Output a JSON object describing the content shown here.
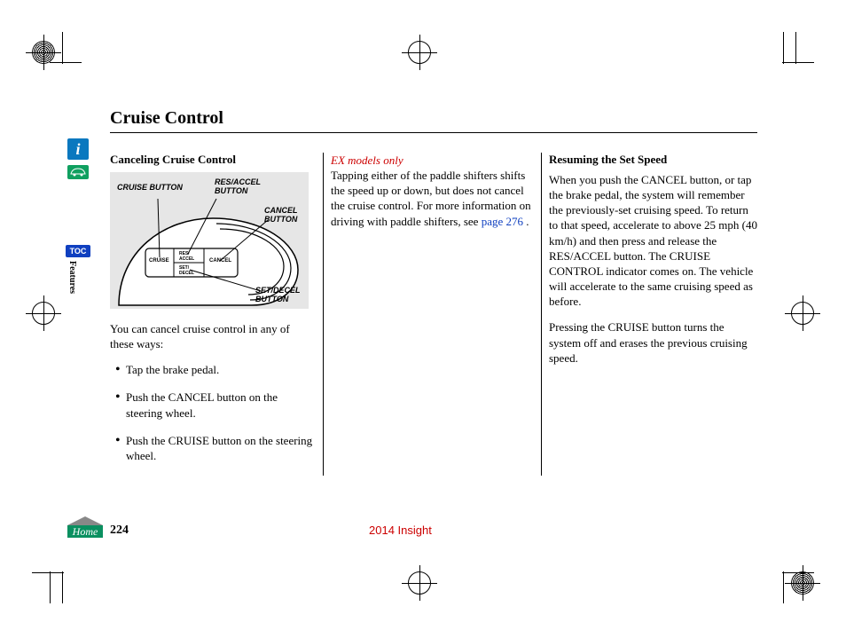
{
  "title": "Cruise Control",
  "footer": {
    "home_label": "Home",
    "page_num": "224",
    "model_year": "2014 Insight"
  },
  "sidebar": {
    "info_icon": "i",
    "toc_label": "TOC",
    "features_label": "Features"
  },
  "col1": {
    "subhead": "Canceling Cruise Control",
    "figure": {
      "cruise_button": "CRUISE BUTTON",
      "res_accel": "RES/ACCEL BUTTON",
      "cancel": "CANCEL BUTTON",
      "set_decel": "SET/DECEL BUTTON",
      "btn_cruise": "CRUISE",
      "btn_res": "RES/ ACCEL",
      "btn_set": "SET/ DECEL",
      "btn_cancel": "CANCEL"
    },
    "intro": "You can cancel cruise control in any of these ways:",
    "bullets": [
      "Tap the brake pedal.",
      "Push the CANCEL button on the steering wheel.",
      "Push the CRUISE button on the steering wheel."
    ]
  },
  "col2": {
    "note_label": "EX models only",
    "note_body_1": "Tapping either of the paddle shifters shifts the speed up or down, but does not cancel the cruise control. For more information on driving with paddle shifters, see ",
    "note_link": "page 276",
    "note_body_2": " ."
  },
  "col3": {
    "subhead": "Resuming the Set Speed",
    "p1": "When you push the CANCEL button, or tap the brake pedal, the system will remember the previously-set cruising speed. To return to that speed, accelerate to above 25 mph (40 km/h) and then press and release the RES/ACCEL button. The CRUISE CONTROL indicator comes on. The vehicle will accelerate to the same cruising speed as before.",
    "p2": "Pressing the CRUISE button turns the system off and erases the previous cruising speed."
  }
}
